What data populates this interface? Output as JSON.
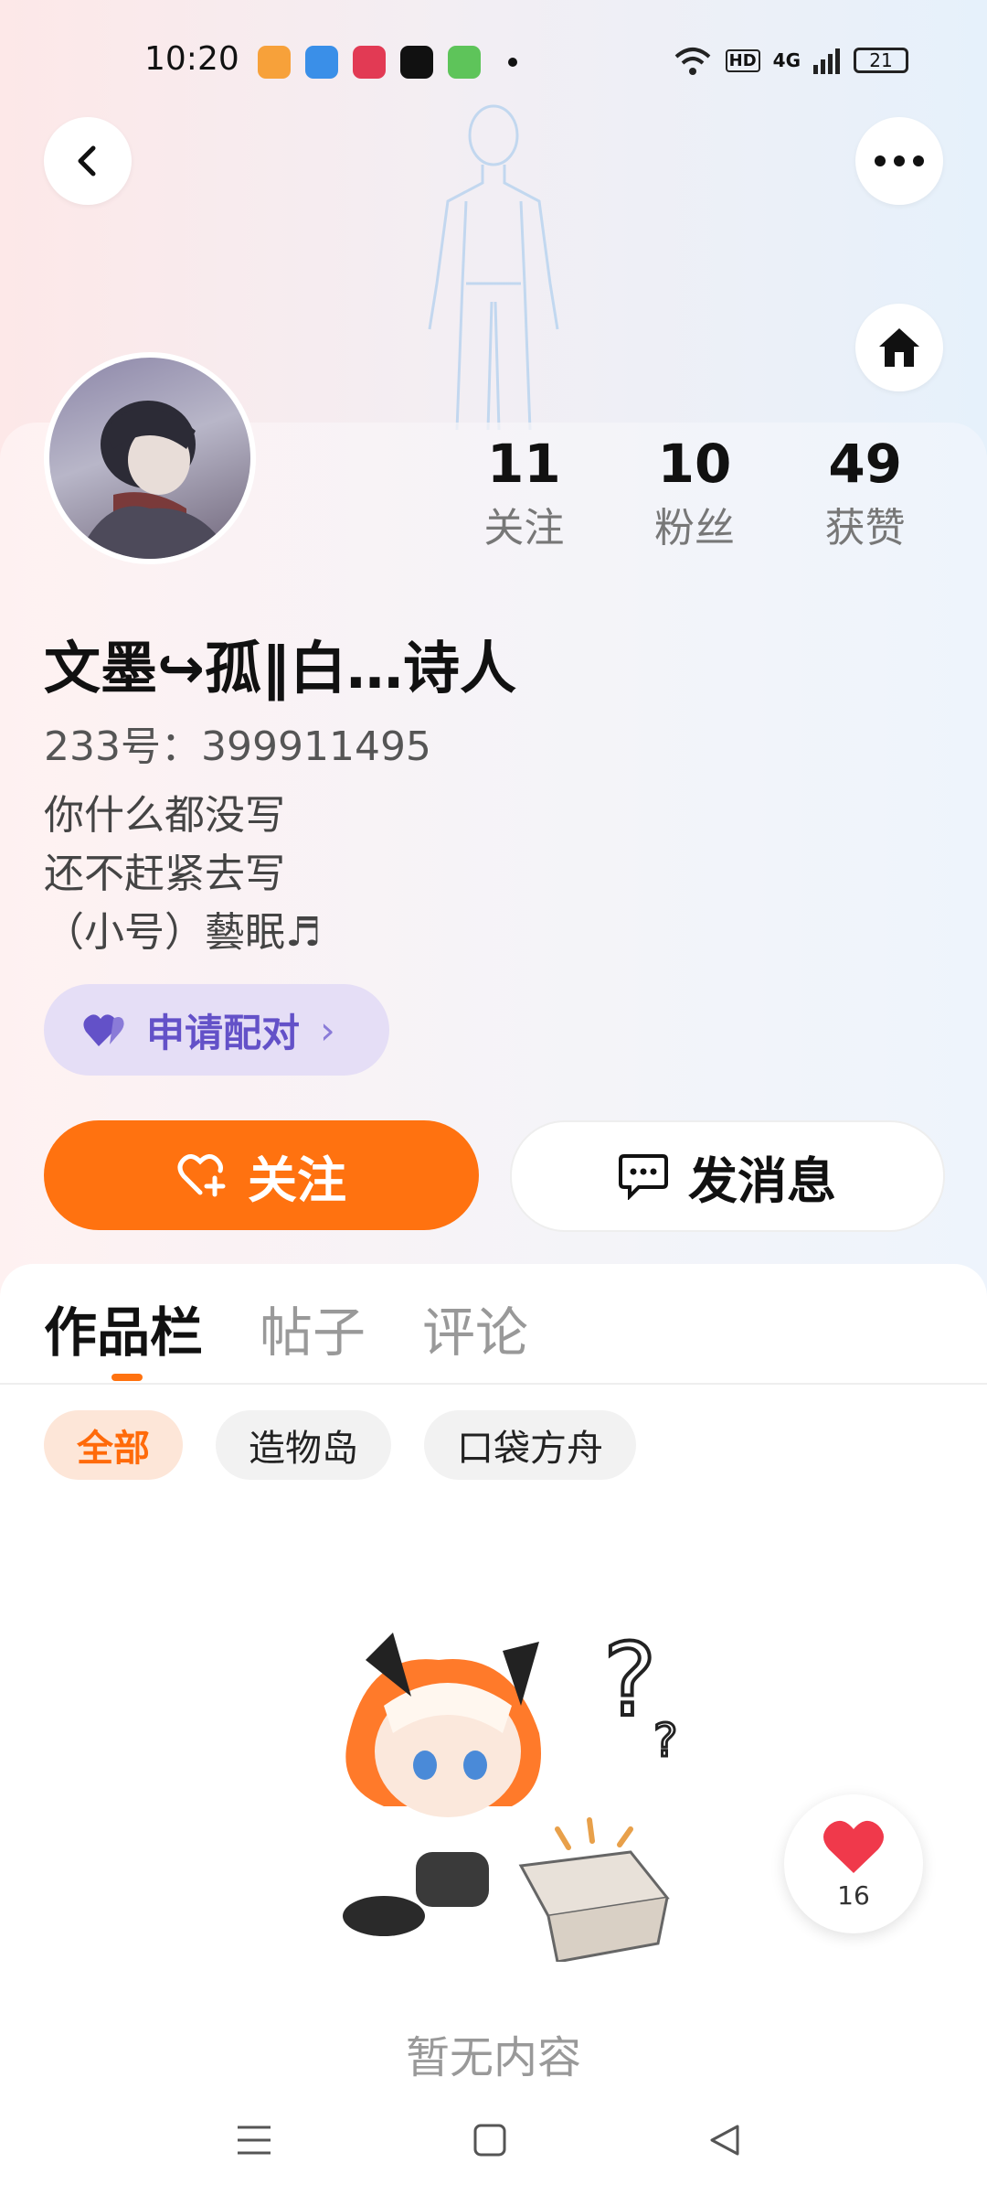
{
  "status_bar": {
    "time": "10:20",
    "network": "4G",
    "hd": "HD",
    "battery": "21"
  },
  "header": {
    "back_icon": "chevron-left-icon",
    "more_icon": "more-horizontal-icon",
    "home_icon": "home-icon"
  },
  "profile": {
    "name": "文墨↪孤‖白…诗人",
    "id_text": "233号：399911495",
    "bio": [
      "你什么都没写",
      "还不赶紧去写",
      "（小号）藝眠♬"
    ],
    "stats": [
      {
        "value": "11",
        "label": "关注"
      },
      {
        "value": "10",
        "label": "粉丝"
      },
      {
        "value": "49",
        "label": "获赞"
      }
    ]
  },
  "match_button": {
    "label": "申请配对"
  },
  "actions": {
    "follow_label": "关注",
    "message_label": "发消息"
  },
  "tabs": [
    {
      "label": "作品栏",
      "active": true
    },
    {
      "label": "帖子",
      "active": false
    },
    {
      "label": "评论",
      "active": false
    }
  ],
  "filters": [
    {
      "label": "全部",
      "active": true
    },
    {
      "label": "造物岛",
      "active": false
    },
    {
      "label": "口袋方舟",
      "active": false
    }
  ],
  "empty_state": {
    "text": "暂无内容"
  },
  "like_fab": {
    "count": "16"
  },
  "colors": {
    "accent": "#ff7210",
    "match_bg": "#e5def6",
    "match_text": "#6351c8",
    "heart": "#f0394b"
  }
}
